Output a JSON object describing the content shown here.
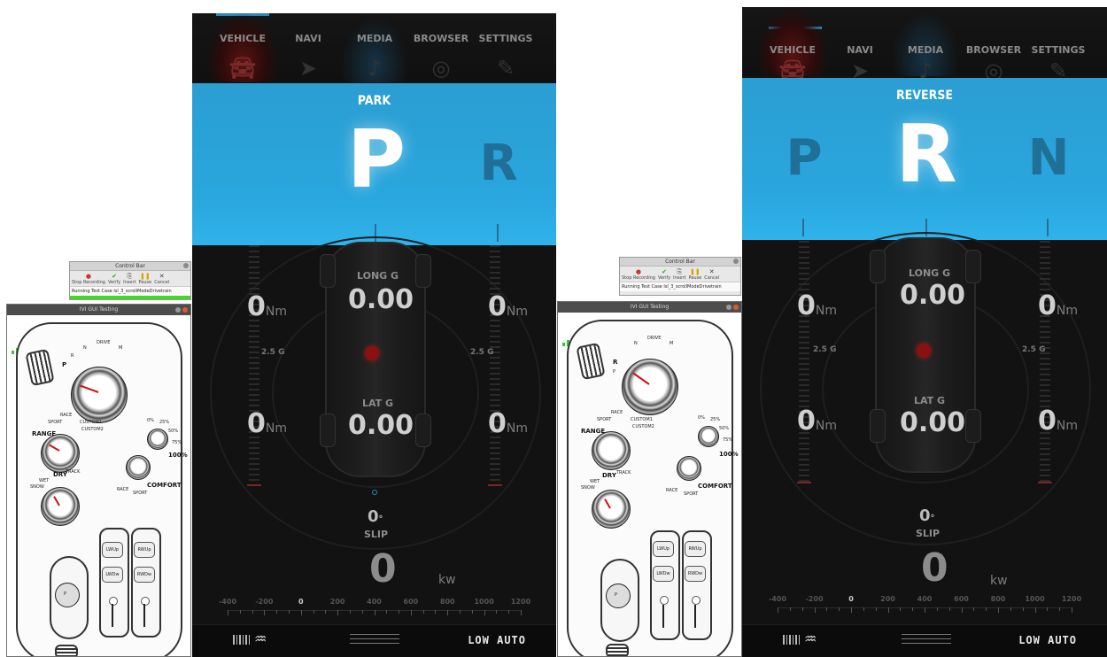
{
  "control_bar": {
    "title": "Control Bar",
    "tools": [
      "Stop Recording",
      "Verify",
      "Insert",
      "Pause",
      "Cancel"
    ],
    "status_left": "Running Test Case lsl_3_scrollModeDrivetrain",
    "status_right": "Running Test Case lsl_3_scrollModeDrivetrain"
  },
  "ivi_window": {
    "title": "IVI GUI Testing",
    "labels": {
      "p": "P",
      "r": "R",
      "n": "N",
      "drive": "DRIVE",
      "m": "M",
      "race": "RACE",
      "sport": "SPORT",
      "custom1": "CUSTOM1",
      "custom2": "CUSTOM2",
      "range": "RANGE",
      "dry": "DRY",
      "track": "TRACK",
      "wet": "WET",
      "snow": "SNOW",
      "pct0": "0%",
      "pct25": "25%",
      "pct50": "50%",
      "pct75": "75%",
      "pct100": "100%",
      "comfort": "COMFORT",
      "race2": "RACE",
      "sport2": "SPORT",
      "lwup": "LWUp",
      "rwup": "RWUp",
      "lwdw": "LWDw",
      "rwdw": "RWDw",
      "p_btn": "P"
    }
  },
  "nav": {
    "items": [
      "VEHICLE",
      "NAVI",
      "MEDIA",
      "BROWSER",
      "SETTINGS"
    ]
  },
  "screen1": {
    "mode_label": "PARK",
    "gear_active": "P",
    "gear_next": "R"
  },
  "screen2": {
    "mode_label": "REVERSE",
    "gear_prev": "P",
    "gear_active": "R",
    "gear_next": "N"
  },
  "gauges": {
    "torque_fl": "0",
    "torque_fr": "0",
    "torque_rl": "0",
    "torque_rr": "0",
    "torque_unit": "Nm",
    "long_g_label": "LONG G",
    "long_g": "0.00",
    "lat_g_label": "LAT G",
    "lat_g": "0.00",
    "g_scale_left": "2.5 G",
    "g_scale_right": "2.5 G",
    "slip_value": "0",
    "slip_unit": "°",
    "slip_label": "SLIP",
    "power_value": "0",
    "power_unit": "kw"
  },
  "power_ruler": [
    "-400",
    "-200",
    "0",
    "200",
    "400",
    "600",
    "800",
    "1000",
    "1200"
  ],
  "bottom_bar": {
    "auto_label": "LOW  AUTO",
    "defrost_icon": "rear-defrost-icon",
    "fan_icon": "fan-level-icon"
  },
  "colors": {
    "gear_band": "#29a6de",
    "accent": "#2b87b8",
    "red_dot": "#8b1010",
    "signal_green": "#32c832"
  }
}
